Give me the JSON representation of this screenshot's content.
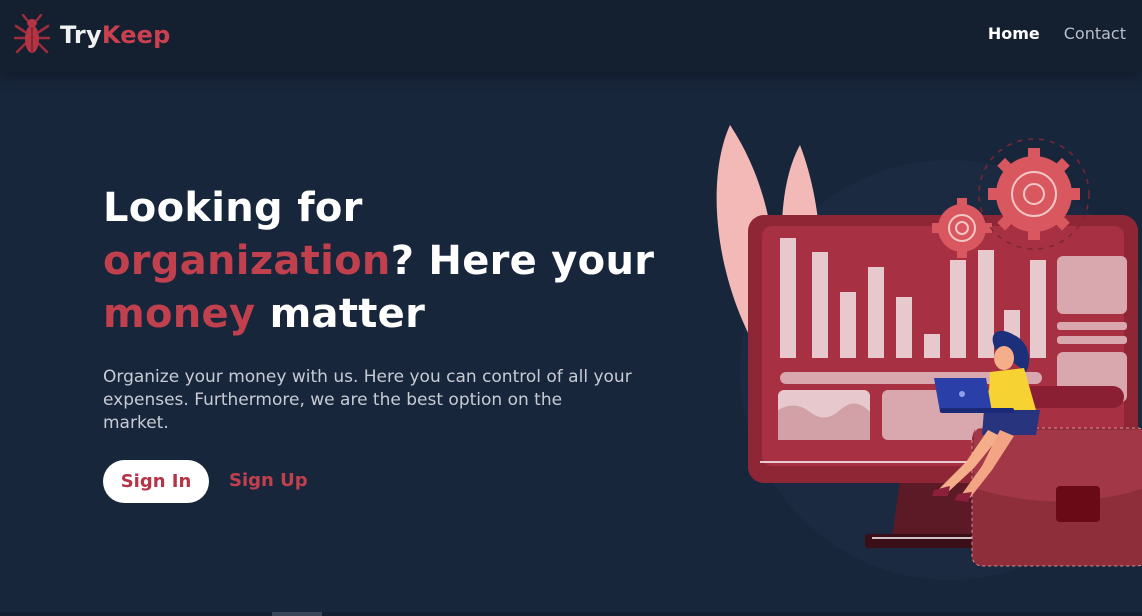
{
  "brand": {
    "name_part1": "Try",
    "name_part2": "Keep",
    "logo_icon": "ant-logo-icon"
  },
  "nav": {
    "links": [
      {
        "label": "Home",
        "active": true
      },
      {
        "label": "Contact",
        "active": false
      }
    ]
  },
  "hero": {
    "title_line1": "Looking for",
    "title_highlight1": "organization",
    "title_line2_rest": "? Here your",
    "title_highlight2": "money",
    "title_line3_rest": " matter",
    "description": "Organize your money with us. Here you can control of all your expenses. Furthermore, we are the best option on the market.",
    "signin_label": "Sign In",
    "signup_label": "Sign Up"
  },
  "illustration": {
    "subject": "woman-with-laptop-on-briefcase-in-front-of-dashboard-monitor"
  },
  "colors": {
    "background": "#18263b",
    "navbar": "#141f30",
    "accent": "#c0404e",
    "text": "#ffffff",
    "muted": "#c7ccd4"
  }
}
